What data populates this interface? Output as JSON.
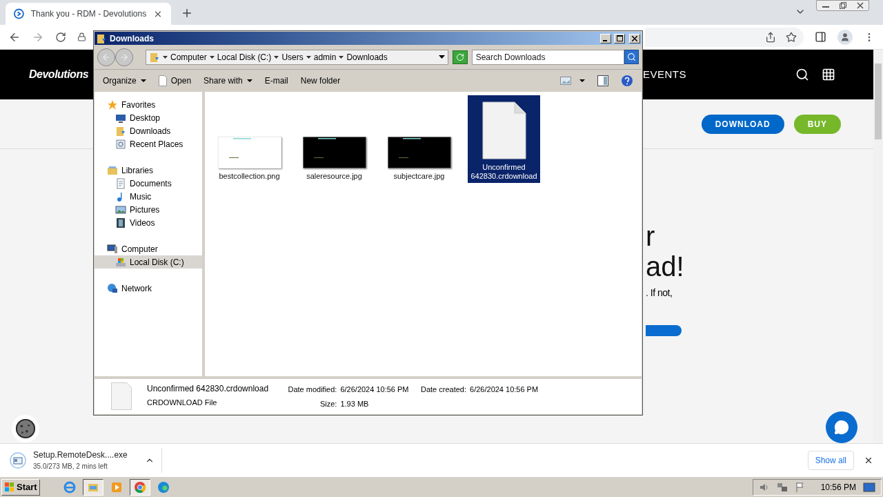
{
  "browser": {
    "tab_title": "Thank you - RDM - Devolutions",
    "site": {
      "logo": "Devolutions",
      "nav_items": [
        "EVENTS"
      ],
      "buttons": [
        {
          "label": "DOWNLOAD",
          "color": "#0068c9"
        },
        {
          "label": "BUY",
          "color": "#76b82a"
        }
      ],
      "hero_lines": [
        "r",
        "ad!"
      ],
      "hero_text": ". If not,"
    }
  },
  "explorer": {
    "title": "Downloads",
    "breadcrumb": [
      "Computer",
      "Local Disk (C:)",
      "Users",
      "admin",
      "Downloads"
    ],
    "search": {
      "placeholder": "Search Downloads"
    },
    "toolbar": [
      {
        "label": "Organize",
        "kind": "menu"
      },
      {
        "label": "Open",
        "kind": "file"
      },
      {
        "label": "Share with",
        "kind": "menu"
      },
      {
        "label": "E-mail",
        "kind": "plain"
      },
      {
        "label": "New folder",
        "kind": "plain"
      }
    ],
    "nav_pane": [
      {
        "label": "Favorites",
        "kind": "star",
        "selected": false,
        "children": [
          {
            "label": "Desktop",
            "kind": "desktop",
            "selected": false
          },
          {
            "label": "Downloads",
            "kind": "folder",
            "selected": false
          },
          {
            "label": "Recent Places",
            "kind": "recent",
            "selected": false
          }
        ]
      },
      {
        "label": "Libraries",
        "kind": "library",
        "selected": false,
        "children": [
          {
            "label": "Documents",
            "kind": "document",
            "selected": false
          },
          {
            "label": "Music",
            "kind": "music",
            "selected": false
          },
          {
            "label": "Pictures",
            "kind": "pictures",
            "selected": false
          },
          {
            "label": "Videos",
            "kind": "videos",
            "selected": false
          }
        ]
      },
      {
        "label": "Computer",
        "kind": "computer",
        "selected": false,
        "children": [
          {
            "label": "Local Disk (C:)",
            "kind": "disk",
            "selected": true
          }
        ]
      },
      {
        "label": "Network",
        "kind": "network",
        "selected": false
      }
    ],
    "files": [
      {
        "name": "bestcollection.png",
        "color": "#ffffff",
        "selected": false
      },
      {
        "name": "saleresource.jpg",
        "color": "#000000",
        "selected": false
      },
      {
        "name": "subjectcare.jpg",
        "color": "#000000",
        "selected": false
      },
      {
        "name": "Unconfirmed 642830.crdownload",
        "kind": "document",
        "color": "#f2f2f2",
        "selected": true
      }
    ],
    "details": {
      "name": "Unconfirmed 642830.crdownload",
      "type": "CRDOWNLOAD File",
      "fields": [
        {
          "label": "Date modified:",
          "value": "6/26/2024 10:56 PM"
        },
        {
          "label": "Size:",
          "value": "1.93 MB"
        },
        {
          "label": "Date created:",
          "value": "6/26/2024 10:56 PM"
        }
      ]
    }
  },
  "download_bar": {
    "file": "Setup.RemoteDesk....exe",
    "status": "35.0/273 MB, 2 mins left",
    "show_all": "Show all"
  },
  "taskbar": {
    "start": "Start",
    "apps": [
      {
        "kind": "ie",
        "active": false
      },
      {
        "kind": "explorer",
        "active": true
      },
      {
        "kind": "media",
        "active": false
      },
      {
        "kind": "chrome",
        "active": true
      },
      {
        "kind": "edge",
        "active": false
      }
    ],
    "clock": "10:56 PM"
  }
}
